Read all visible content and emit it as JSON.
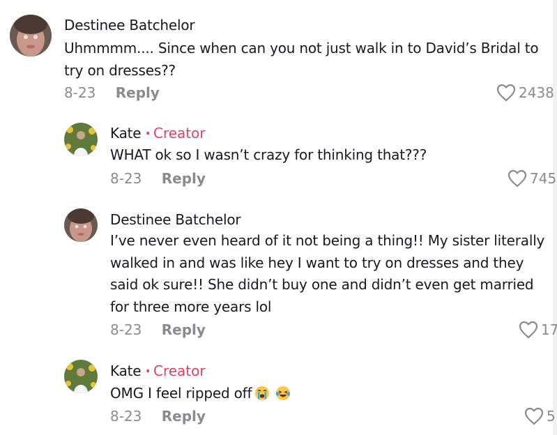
{
  "creator_label": "Creator",
  "separator": "·",
  "reply_label": "Reply",
  "comments": [
    {
      "username": "Destinee Batchelor",
      "text": "Uhmmmm.... Since when can you not just walk in to David’s Bridal to try on dresses??",
      "date": "8-23",
      "likes": "2438",
      "is_creator": false
    }
  ],
  "replies": [
    {
      "username": "Kate",
      "text": "WHAT ok so I wasn’t crazy for thinking that???",
      "date": "8-23",
      "likes": "745",
      "is_creator": true
    },
    {
      "username": "Destinee Batchelor",
      "text": "I’ve never even heard of it not being a thing!! My sister literally walked in and was like hey I want to try on dresses and they said ok sure!! She didn’t buy one and didn’t even get married for three more years lol",
      "date": "8-23",
      "likes": "17",
      "is_creator": false
    },
    {
      "username": "Kate",
      "text": "OMG I feel ripped off",
      "date": "8-23",
      "likes": "5",
      "is_creator": true,
      "emojis": [
        "crying-face-emoji",
        "laughing-tears-emoji"
      ]
    }
  ],
  "colors": {
    "creator": "#e13f63",
    "meta": "#8a8b91",
    "text": "#161823"
  }
}
